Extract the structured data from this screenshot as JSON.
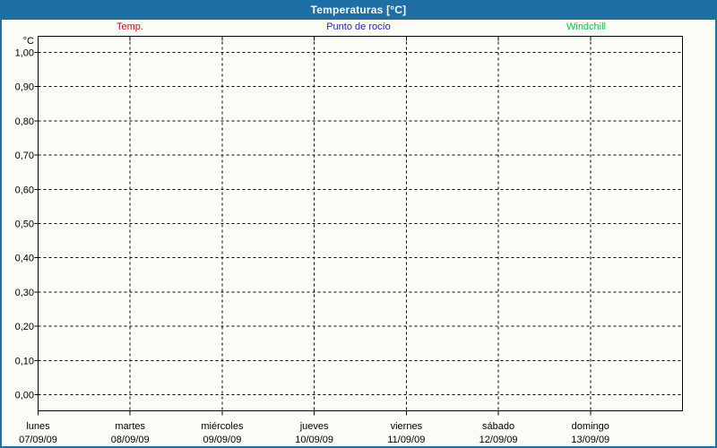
{
  "window": {
    "title": "Temperaturas [°C]"
  },
  "colors": {
    "header": "#1d6fa6",
    "border": "#1d6fa6",
    "background": "#fbfcf6",
    "grid": "#000000",
    "axis": "#000000"
  },
  "chart_data": {
    "type": "line",
    "title": "Temperaturas [°C]",
    "ylabel": "°C",
    "y_unit": "°C",
    "ylim": [
      0.0,
      1.0
    ],
    "y_tick_step": 0.1,
    "y_tick_labels": [
      "1,00",
      "0,90",
      "0,80",
      "0,70",
      "0,60",
      "0,50",
      "0,40",
      "0,30",
      "0,20",
      "0,10",
      "0,00"
    ],
    "grid": "dashed",
    "legend_position": "top",
    "x_categories": [
      {
        "day": "lunes",
        "date": "07/09/09"
      },
      {
        "day": "martes",
        "date": "08/09/09"
      },
      {
        "day": "miércoles",
        "date": "09/09/09"
      },
      {
        "day": "jueves",
        "date": "10/09/09"
      },
      {
        "day": "viernes",
        "date": "11/09/09"
      },
      {
        "day": "sábado",
        "date": "12/09/09"
      },
      {
        "day": "domingo",
        "date": "13/09/09"
      }
    ],
    "series": [
      {
        "name": "Temp.",
        "color": "#e60000",
        "values": []
      },
      {
        "name": "Punto de rocío",
        "color": "#2020cc",
        "values": []
      },
      {
        "name": "Windchill",
        "color": "#00cc44",
        "values": []
      }
    ]
  }
}
